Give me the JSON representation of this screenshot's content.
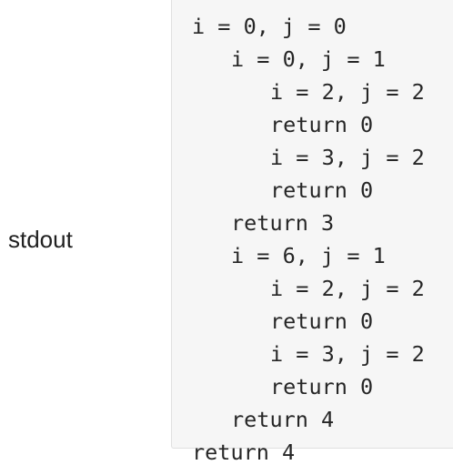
{
  "label": "stdout",
  "lines": [
    {
      "indent": 0,
      "text": "i = 0, j = 0"
    },
    {
      "indent": 1,
      "text": "i = 0, j = 1"
    },
    {
      "indent": 2,
      "text": "i = 2, j = 2"
    },
    {
      "indent": 2,
      "text": "return 0"
    },
    {
      "indent": 2,
      "text": "i = 3, j = 2"
    },
    {
      "indent": 2,
      "text": "return 0"
    },
    {
      "indent": 1,
      "text": "return 3"
    },
    {
      "indent": 1,
      "text": "i = 6, j = 1"
    },
    {
      "indent": 2,
      "text": "i = 2, j = 2"
    },
    {
      "indent": 2,
      "text": "return 0"
    },
    {
      "indent": 2,
      "text": "i = 3, j = 2"
    },
    {
      "indent": 2,
      "text": "return 0"
    },
    {
      "indent": 1,
      "text": "return 4"
    },
    {
      "indent": 0,
      "text": "return 4"
    }
  ]
}
